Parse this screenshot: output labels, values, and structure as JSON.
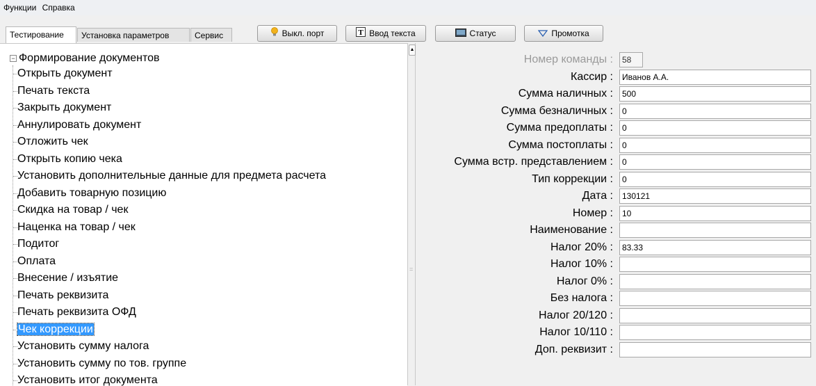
{
  "menu": {
    "items": [
      "Функции",
      "Справка"
    ]
  },
  "tabs": [
    {
      "label": "Тестирование",
      "active": true
    },
    {
      "label": "Установка параметров",
      "active": false
    },
    {
      "label": "Сервис",
      "active": false
    }
  ],
  "toolbar": {
    "port_label": "Выкл. порт",
    "text_input_label": "Ввод текста",
    "status_label": "Статус",
    "feed_label": "Промотка",
    "port_icon_color": "#f2b21c"
  },
  "tree": {
    "root": "Формирование документов",
    "items": [
      "Открыть документ",
      "Печать текста",
      "Закрыть документ",
      "Аннулировать документ",
      "Отложить чек",
      "Открыть копию чека",
      "Установить дополнительные данные для предмета расчета",
      "Добавить товарную позицию",
      "Скидка на товар / чек",
      "Наценка на товар / чек",
      "Подитог",
      "Оплата",
      "Внесение / изъятие",
      "Печать реквизита",
      "Печать реквизита ОФД",
      "Чек коррекции",
      "Установить сумму налога",
      "Установить сумму по тов. группе",
      "Установить итог документа"
    ],
    "selected_index": 15,
    "selection_color": "#3399ff"
  },
  "form": {
    "fields": [
      {
        "label": "Номер команды :",
        "value": "58"
      },
      {
        "label": "Кассир :",
        "value": "Иванов А.А."
      },
      {
        "label": "Сумма наличных :",
        "value": "500"
      },
      {
        "label": "Сумма безналичных :",
        "value": "0"
      },
      {
        "label": "Сумма предоплаты :",
        "value": "0"
      },
      {
        "label": "Сумма постоплаты :",
        "value": "0"
      },
      {
        "label": "Сумма встр. представлением :",
        "value": "0"
      },
      {
        "label": "Тип коррекции :",
        "value": "0"
      },
      {
        "label": "Дата :",
        "value": "130121"
      },
      {
        "label": "Номер :",
        "value": "10"
      },
      {
        "label": "Наименование :",
        "value": ""
      },
      {
        "label": "Налог 20% :",
        "value": "83.33"
      },
      {
        "label": "Налог 10% :",
        "value": ""
      },
      {
        "label": "Налог 0% :",
        "value": ""
      },
      {
        "label": "Без налога :",
        "value": ""
      },
      {
        "label": "Налог 20/120 :",
        "value": ""
      },
      {
        "label": "Налог 10/110 :",
        "value": ""
      },
      {
        "label": "Доп. реквизит :",
        "value": ""
      }
    ]
  }
}
